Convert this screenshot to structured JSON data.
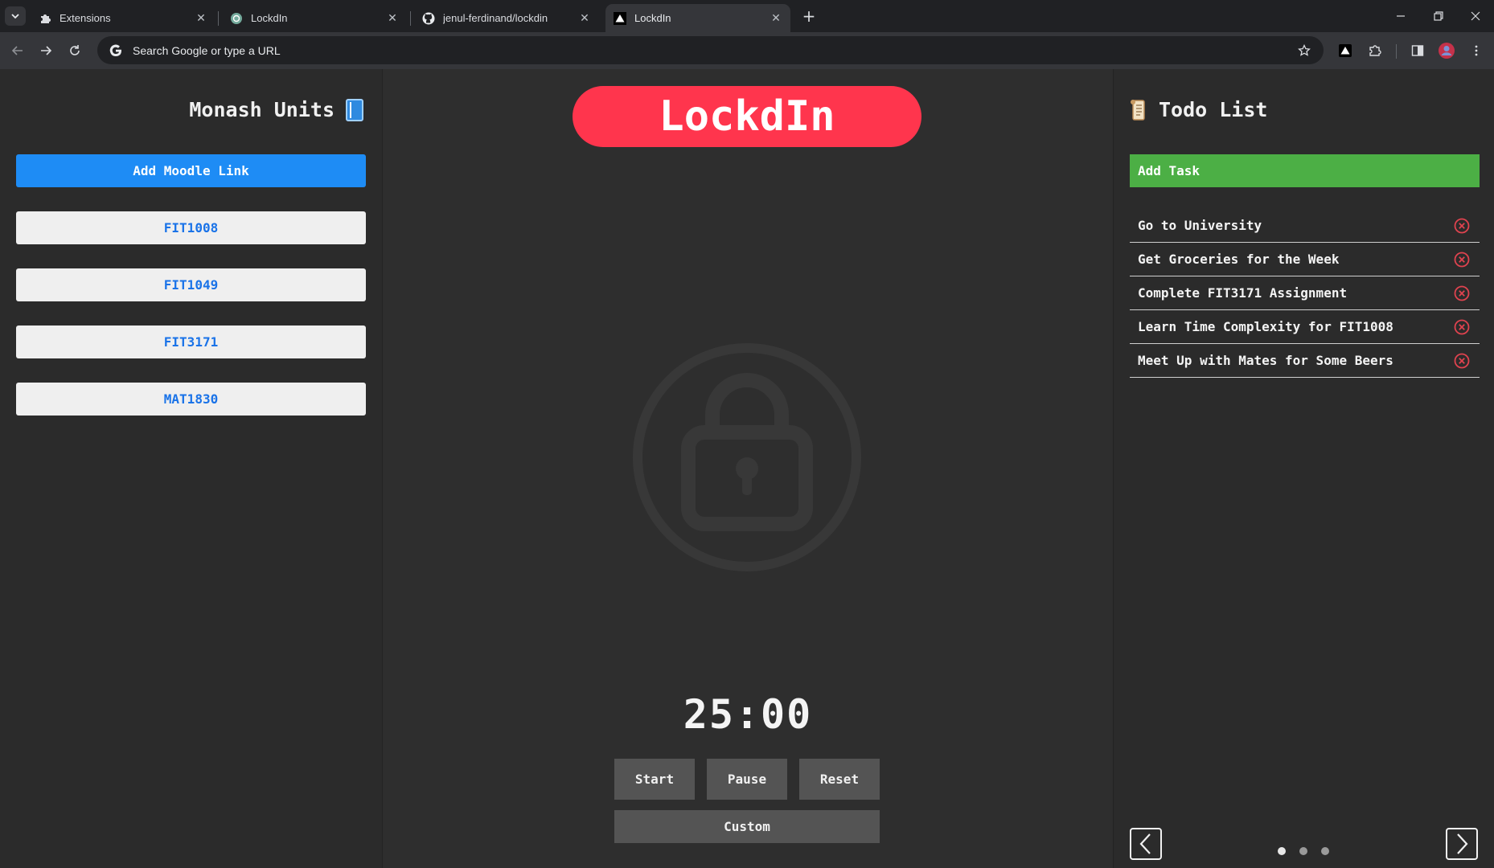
{
  "browser": {
    "tabs": [
      {
        "title": "Extensions",
        "favicon": "puzzle-icon"
      },
      {
        "title": "LockdIn",
        "favicon": "chatgpt-icon"
      },
      {
        "title": "jenul-ferdinand/lockdin",
        "favicon": "github-icon"
      },
      {
        "title": "LockdIn",
        "favicon": "triangle-icon",
        "active": true
      }
    ],
    "address_bar": {
      "placeholder": "Search Google or type a URL"
    }
  },
  "left_panel": {
    "title": "Monash Units",
    "title_icon": "blue-book-icon",
    "add_button": "Add Moodle Link",
    "units": [
      "FIT1008",
      "FIT1049",
      "FIT3171",
      "MAT1830"
    ]
  },
  "center": {
    "logo": "LockdIn",
    "timer": "25:00",
    "buttons": {
      "start": "Start",
      "pause": "Pause",
      "reset": "Reset",
      "custom": "Custom"
    }
  },
  "right_panel": {
    "title": "Todo List",
    "title_icon": "scroll-icon",
    "add_button": "Add Task",
    "tasks": [
      "Go to University",
      "Get Groceries for the Week",
      "Complete FIT3171 Assignment",
      "Learn Time Complexity for FIT1008",
      "Meet Up with Mates for Some Beers"
    ],
    "pagination": {
      "pages": 3,
      "current": 1
    }
  },
  "colors": {
    "accent_red": "#ff354d",
    "moodle_blue": "#1e8cf5",
    "task_green": "#4caf45",
    "delete_red": "#e0434f"
  }
}
